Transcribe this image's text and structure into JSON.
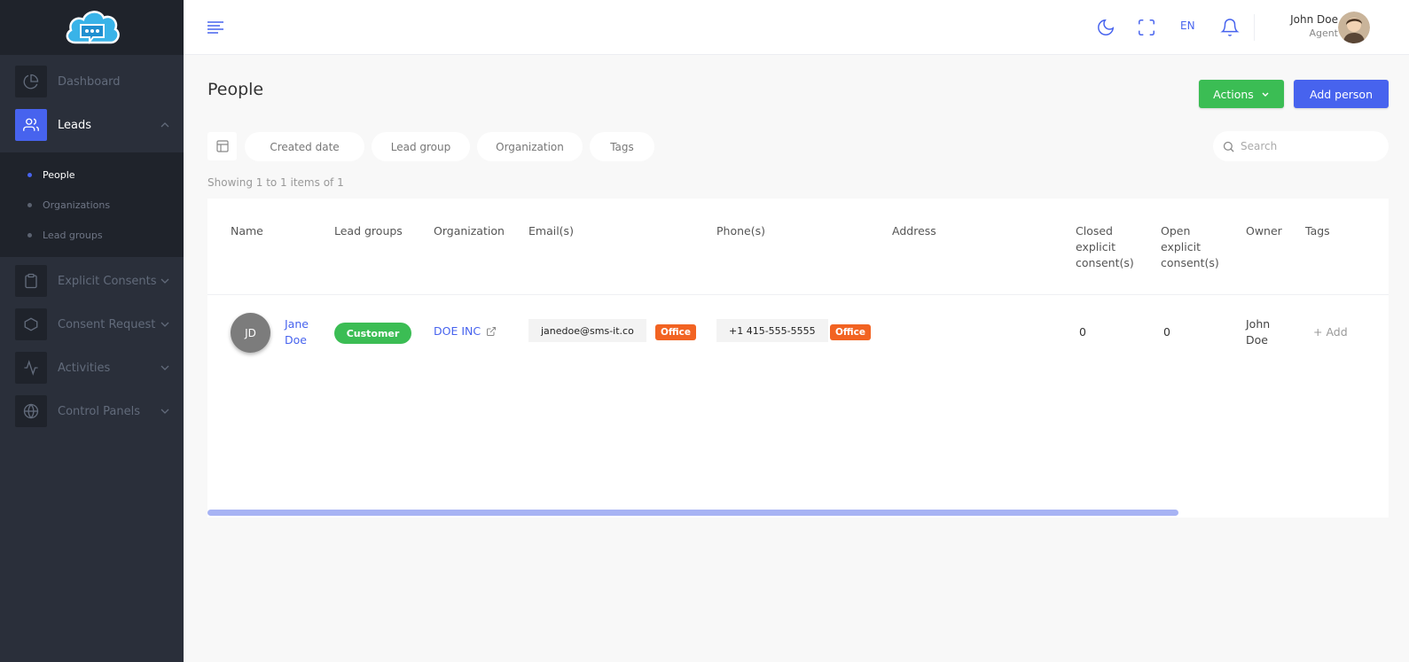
{
  "sidebar": {
    "items": [
      {
        "label": "Dashboard",
        "icon": "pie-chart-icon"
      },
      {
        "label": "Leads",
        "icon": "users-icon",
        "active": true
      },
      {
        "label": "Explicit Consents",
        "icon": "clipboard-icon"
      },
      {
        "label": "Consent Request",
        "icon": "hexagon-icon"
      },
      {
        "label": "Activities",
        "icon": "activity-icon"
      },
      {
        "label": "Control Panels",
        "icon": "globe-icon"
      }
    ],
    "subitems": [
      {
        "label": "People",
        "active": true
      },
      {
        "label": "Organizations"
      },
      {
        "label": "Lead groups"
      }
    ]
  },
  "header": {
    "lang": "EN",
    "user_name": "John Doe",
    "user_role": "Agent"
  },
  "page": {
    "title": "People",
    "actions_label": "Actions",
    "add_label": "Add person",
    "filters": [
      "Created date",
      "Lead group",
      "Organization",
      "Tags"
    ],
    "search_placeholder": "Search",
    "showing": "Showing 1 to 1 items of 1"
  },
  "table": {
    "headers": {
      "name": "Name",
      "lead_groups": "Lead groups",
      "organization": "Organization",
      "emails": "Email(s)",
      "phones": "Phone(s)",
      "address": "Address",
      "closed_l1": "Closed",
      "closed_l2": "explicit",
      "closed_l3": "consent(s)",
      "open_l1": "Open",
      "open_l2": "explicit",
      "open_l3": "consent(s)",
      "owner": "Owner",
      "tags": "Tags"
    },
    "rows": [
      {
        "initials": "JD",
        "first_name": "Jane",
        "last_name": "Doe",
        "lead_group": "Customer",
        "organization": "DOE INC",
        "email": "janedoe@sms-it.co",
        "email_type": "Office",
        "phone": "+1 415-555-5555",
        "phone_type": "Office",
        "address": "",
        "closed": "0",
        "open": "0",
        "owner_first": "John",
        "owner_last": "Doe",
        "tags_add": "+ Add"
      }
    ]
  },
  "colors": {
    "accent": "#4763ee",
    "success": "#3bbd54",
    "office_badge": "#f26322",
    "sidebar_bg": "#2a2f3a"
  }
}
